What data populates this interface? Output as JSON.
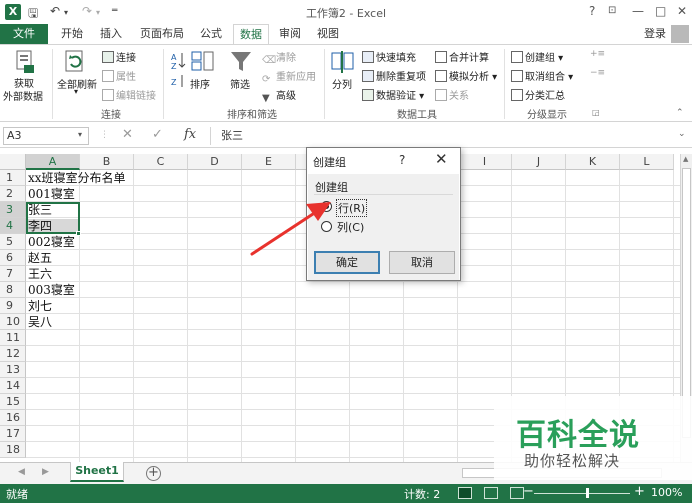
{
  "titlebar": {
    "title": "工作簿2 - Excel",
    "app_icon_letter": "X",
    "help": "?",
    "minimize": "—",
    "restore": "□",
    "close": "✕"
  },
  "tabs": [
    {
      "label": "文件"
    },
    {
      "label": "开始"
    },
    {
      "label": "插入"
    },
    {
      "label": "页面布局"
    },
    {
      "label": "公式"
    },
    {
      "label": "数据"
    },
    {
      "label": "审阅"
    },
    {
      "label": "视图"
    }
  ],
  "active_tab": "数据",
  "login": "登录",
  "ribbon": {
    "get_external_1": "获取",
    "get_external_2": "外部数据",
    "refresh_all": "全部刷新",
    "connections": "连接",
    "properties": "属性",
    "edit_links": "编辑链接",
    "group_connections": "连接",
    "sort": "排序",
    "filter": "筛选",
    "clear": "清除",
    "reapply": "重新应用",
    "advanced": "高级",
    "group_sort_filter": "排序和筛选",
    "text_to_columns": "分列",
    "flash_fill": "快速填充",
    "remove_duplicates": "删除重复项",
    "data_validation": "数据验证",
    "consolidate": "合并计算",
    "what_if": "模拟分析",
    "relationships": "关系",
    "group_data_tools": "数据工具",
    "group": "创建组",
    "ungroup": "取消组合",
    "subtotal": "分类汇总",
    "group_outline": "分级显示"
  },
  "formula_bar": {
    "name_box": "A3",
    "content": "张三"
  },
  "grid": {
    "columns": [
      "A",
      "B",
      "C",
      "D",
      "E",
      "F",
      "G",
      "H",
      "I",
      "J",
      "K",
      "L"
    ],
    "rows": [
      "1",
      "2",
      "3",
      "4",
      "5",
      "6",
      "7",
      "8",
      "9",
      "10",
      "11",
      "12",
      "13",
      "14",
      "15",
      "16",
      "17",
      "18"
    ],
    "cells": [
      "xx班寝室分布名单",
      "001寝室",
      "张三",
      "李四",
      "002寝室",
      "赵五",
      "王六",
      "003寝室",
      "刘七",
      "吴八"
    ]
  },
  "sheet_tab": "Sheet1",
  "add_sheet": "+",
  "status": {
    "ready": "就绪",
    "count": "计数: 2",
    "zoom": "100%"
  },
  "dialog": {
    "title": "创建组",
    "help": "?",
    "close": "✕",
    "group_label": "创建组",
    "option_rows": "行(R)",
    "option_columns": "列(C)",
    "ok": "确定",
    "cancel": "取消",
    "selected": "rows"
  },
  "watermark": {
    "main": "百科全说",
    "sub": "助你轻松解决"
  },
  "colors": {
    "excel_green": "#217346",
    "annotation_red": "#e8322d",
    "watermark_green": "#2a9f5a"
  }
}
